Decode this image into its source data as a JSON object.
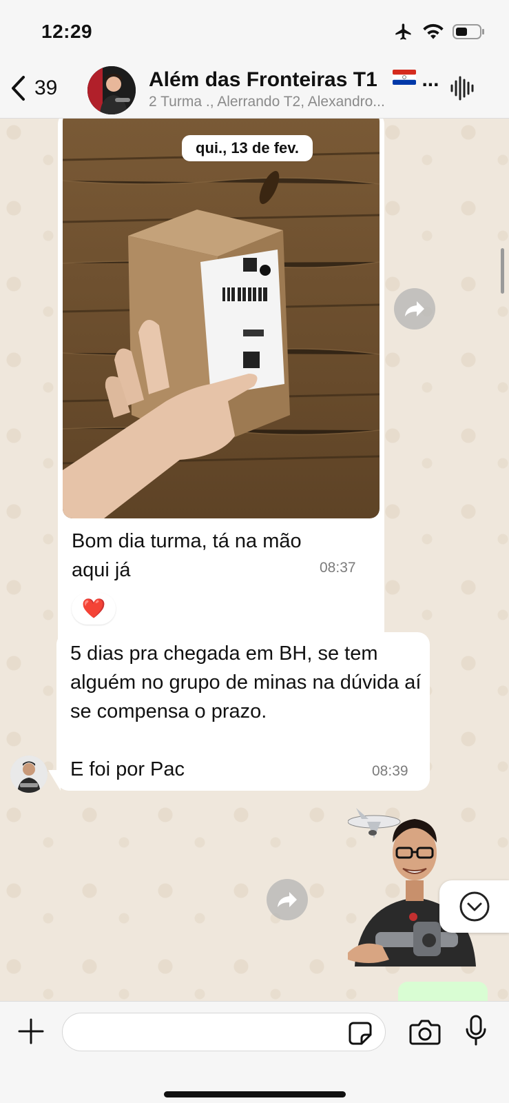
{
  "status_bar": {
    "time": "12:29"
  },
  "header": {
    "back_count": "39",
    "title": "Além das Fronteiras T1",
    "title_more": "...",
    "subtitle": "2 Turma ., Alerrando T2, Alexandro..."
  },
  "chat": {
    "date_pill": "qui., 13 de fev.",
    "messages": [
      {
        "type": "image",
        "caption": "Bom dia turma, tá na mão aqui já",
        "time": "08:37",
        "reaction": "❤️"
      },
      {
        "type": "text",
        "body": "5 dias pra chegada em BH, se tem alguém no grupo de minas na dúvida aí se compensa o prazo.\n\nE foi por Pac",
        "time": "08:39"
      },
      {
        "type": "sticker"
      }
    ]
  },
  "input_bar": {
    "placeholder": ""
  },
  "icons": [
    "chevron-left-icon",
    "airplane-icon",
    "wifi-icon",
    "battery-icon",
    "voice-chat-icon",
    "forward-icon",
    "chevron-down-icon",
    "plus-icon",
    "sticker-icon",
    "camera-icon",
    "microphone-icon"
  ],
  "colors": {
    "chat_bg": "#efe7dc",
    "bubble_in": "#ffffff",
    "bubble_out": "#d9fdd3",
    "header_bg": "#f6f6f6"
  }
}
